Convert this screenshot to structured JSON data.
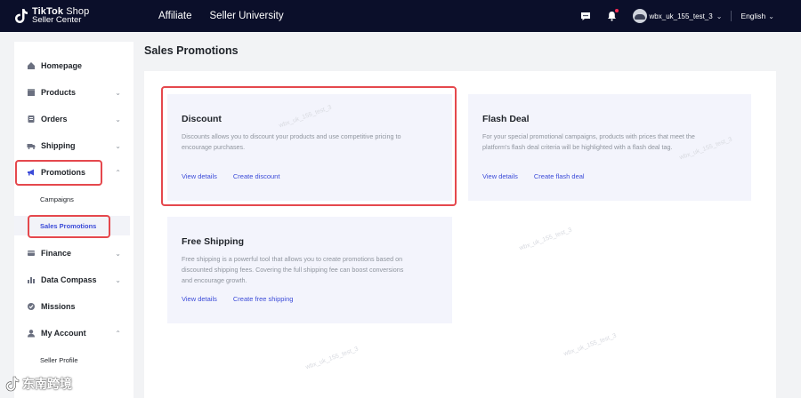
{
  "header": {
    "logo_line1_bold": "TikTok",
    "logo_line1_rest": " Shop",
    "logo_line2": "Seller Center",
    "nav": [
      "Affiliate",
      "Seller University"
    ],
    "account": "wbx_uk_155_test_3",
    "language": "English"
  },
  "sidebar": {
    "items": [
      {
        "label": "Homepage",
        "icon": "home-icon"
      },
      {
        "label": "Products",
        "icon": "products-icon"
      },
      {
        "label": "Orders",
        "icon": "orders-icon"
      },
      {
        "label": "Shipping",
        "icon": "shipping-icon"
      },
      {
        "label": "Promotions",
        "icon": "megaphone-icon"
      },
      {
        "label": "Finance",
        "icon": "finance-icon"
      },
      {
        "label": "Data Compass",
        "icon": "chart-icon"
      },
      {
        "label": "Missions",
        "icon": "missions-icon"
      },
      {
        "label": "My Account",
        "icon": "account-icon"
      }
    ],
    "promotions_sub": [
      "Campaigns",
      "Sales Promotions"
    ],
    "account_sub": [
      "Seller Profile"
    ]
  },
  "page": {
    "title": "Sales Promotions"
  },
  "cards": [
    {
      "title": "Discount",
      "desc1": "Discounts allows you to discount your products and use competitive pricing to",
      "desc2": "encourage purchases.",
      "link1": "View details",
      "link2": "Create discount"
    },
    {
      "title": "Flash Deal",
      "desc1": "For your special promotional campaigns, products with prices that meet the",
      "desc2": "platform's flash deal criteria will be highlighted with a flash deal tag.",
      "link1": "View details",
      "link2": "Create flash deal"
    },
    {
      "title": "Free Shipping",
      "desc1": "Free shipping is a powerful tool that allows you to create promotions based on",
      "desc2": "discounted shipping fees. Covering the full shipping fee can boost conversions",
      "desc3": "and encourage growth.",
      "link1": "View details",
      "link2": "Create free shipping"
    }
  ],
  "watermark_text": "wbx_uk_155_test_3",
  "footer_logo": "东南跨境",
  "colors": {
    "topbar": "#0b0f2a",
    "link": "#3b4bd8",
    "highlight": "#e5484d",
    "card_bg": "#f3f4fc"
  }
}
